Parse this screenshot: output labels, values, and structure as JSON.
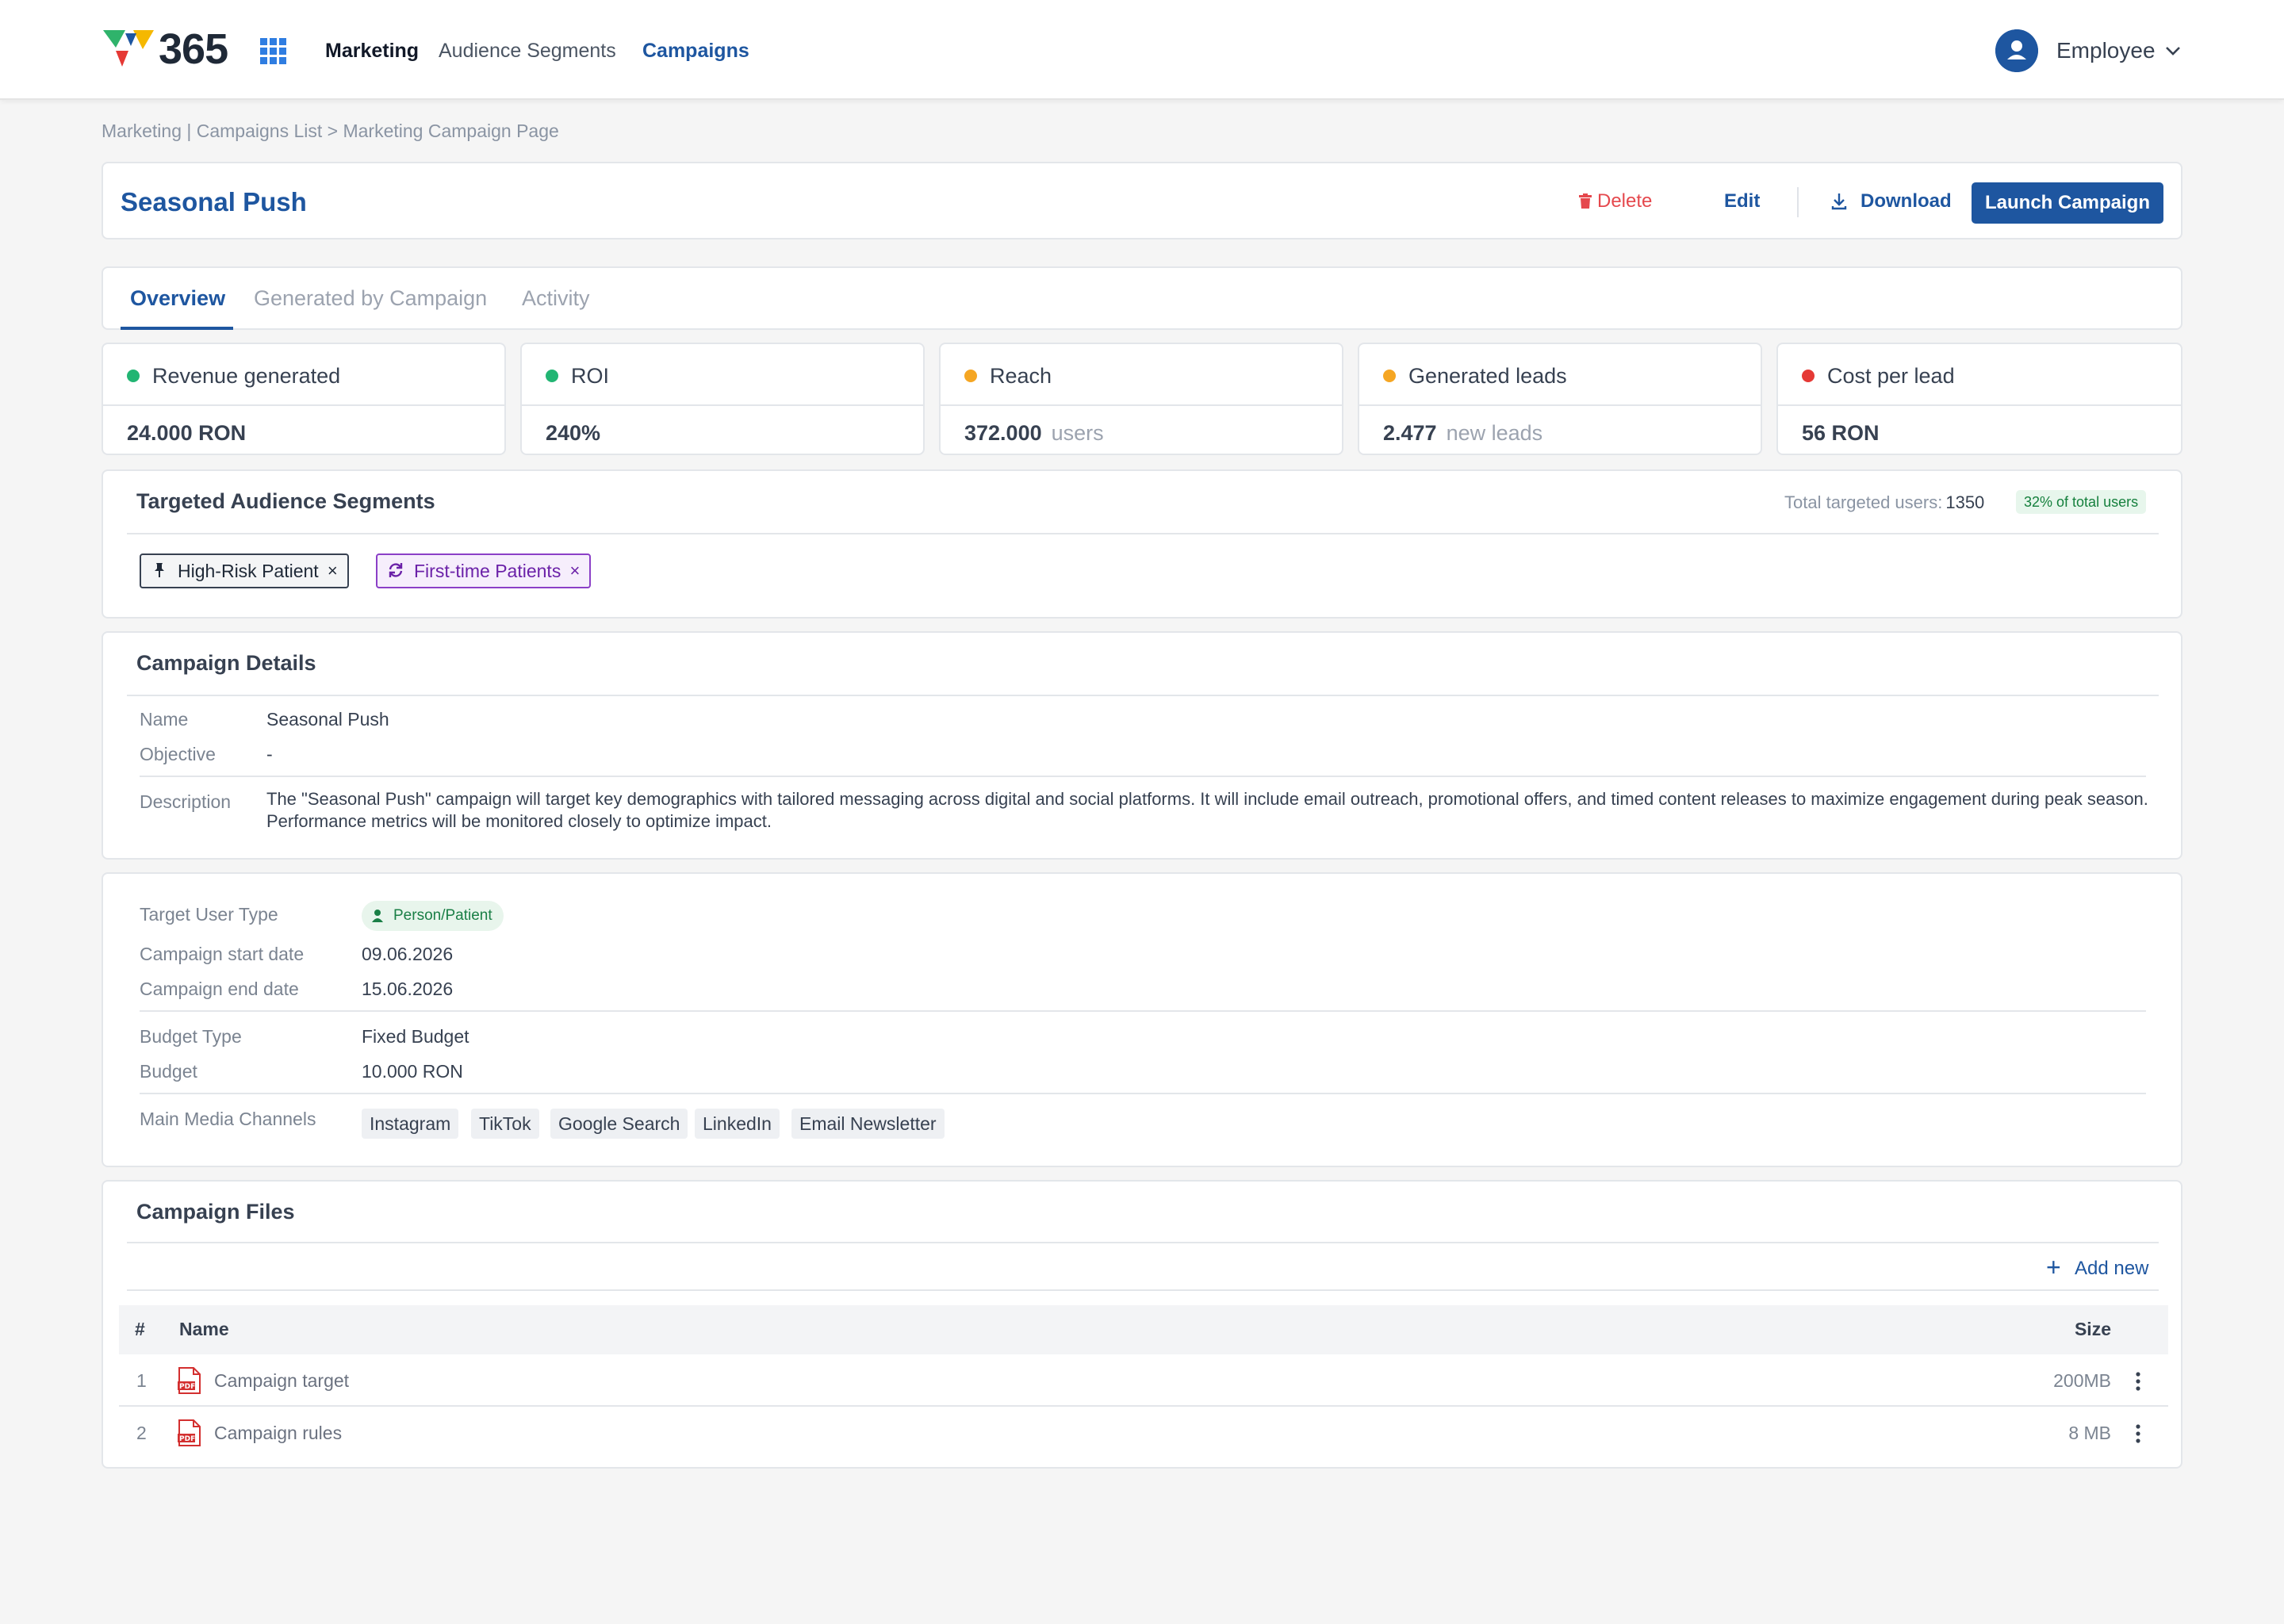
{
  "header": {
    "brand": "365",
    "nav": [
      "Marketing",
      "Audience Segments",
      "Campaigns"
    ],
    "user": "Employee",
    "colors": {
      "primary": "#1e56a0",
      "logo": [
        "#2fb36b",
        "#f5b800",
        "#e53935",
        "#1e56a0"
      ]
    }
  },
  "breadcrumb": "Marketing | Campaigns List > Marketing Campaign Page",
  "page": {
    "title": "Seasonal Push",
    "actions": {
      "delete": "Delete",
      "edit": "Edit",
      "download": "Download",
      "launch": "Launch Campaign"
    }
  },
  "tabs": [
    "Overview",
    "Generated by Campaign",
    "Activity"
  ],
  "kpis": [
    {
      "label": "Revenue generated",
      "value": "24.000 RON",
      "unit": "",
      "color": "#22b573"
    },
    {
      "label": "ROI",
      "value": "240%",
      "unit": "",
      "color": "#22b573"
    },
    {
      "label": "Reach",
      "value": "372.000",
      "unit": "users",
      "color": "#f5a623"
    },
    {
      "label": "Generated leads",
      "value": "2.477",
      "unit": "new leads",
      "color": "#f5a623"
    },
    {
      "label": "Cost per lead",
      "value": "56 RON",
      "unit": "",
      "color": "#e53935"
    }
  ],
  "segments": {
    "title": "Targeted Audience Segments",
    "total_label": "Total targeted users:",
    "total_value": "1350",
    "pct": "32%  of total users",
    "chips": [
      {
        "label": "High-Risk Patient",
        "icon": "pin-icon"
      },
      {
        "label": "First-time Patients",
        "icon": "refresh-icon"
      }
    ]
  },
  "details": {
    "title": "Campaign Details",
    "name_label": "Name",
    "name": "Seasonal Push",
    "objective_label": "Objective",
    "objective": "-",
    "description_label": "Description",
    "description": "The \"Seasonal Push\" campaign will target key demographics with tailored messaging across digital and social platforms. It will include email outreach, promotional offers, and timed content releases to maximize engagement during peak season. Performance metrics will be monitored closely to optimize impact."
  },
  "target": {
    "user_type_label": "Target User Type",
    "user_type": "Person/Patient",
    "start_label": "Campaign start date",
    "start": "09.06.2026",
    "end_label": "Campaign end date",
    "end": "15.06.2026",
    "budget_type_label": "Budget Type",
    "budget_type": "Fixed Budget",
    "budget_label": "Budget",
    "budget": "10.000 RON",
    "channels_label": "Main Media Channels",
    "channels": [
      "Instagram",
      "TikTok",
      "Google Search",
      "LinkedIn",
      "Email Newsletter"
    ]
  },
  "files": {
    "title": "Campaign Files",
    "add_new": "Add new",
    "columns": {
      "num": "#",
      "name": "Name",
      "size": "Size"
    },
    "rows": [
      {
        "num": "1",
        "name": "Campaign target",
        "size": "200MB"
      },
      {
        "num": "2",
        "name": "Campaign rules",
        "size": "8 MB"
      }
    ]
  }
}
